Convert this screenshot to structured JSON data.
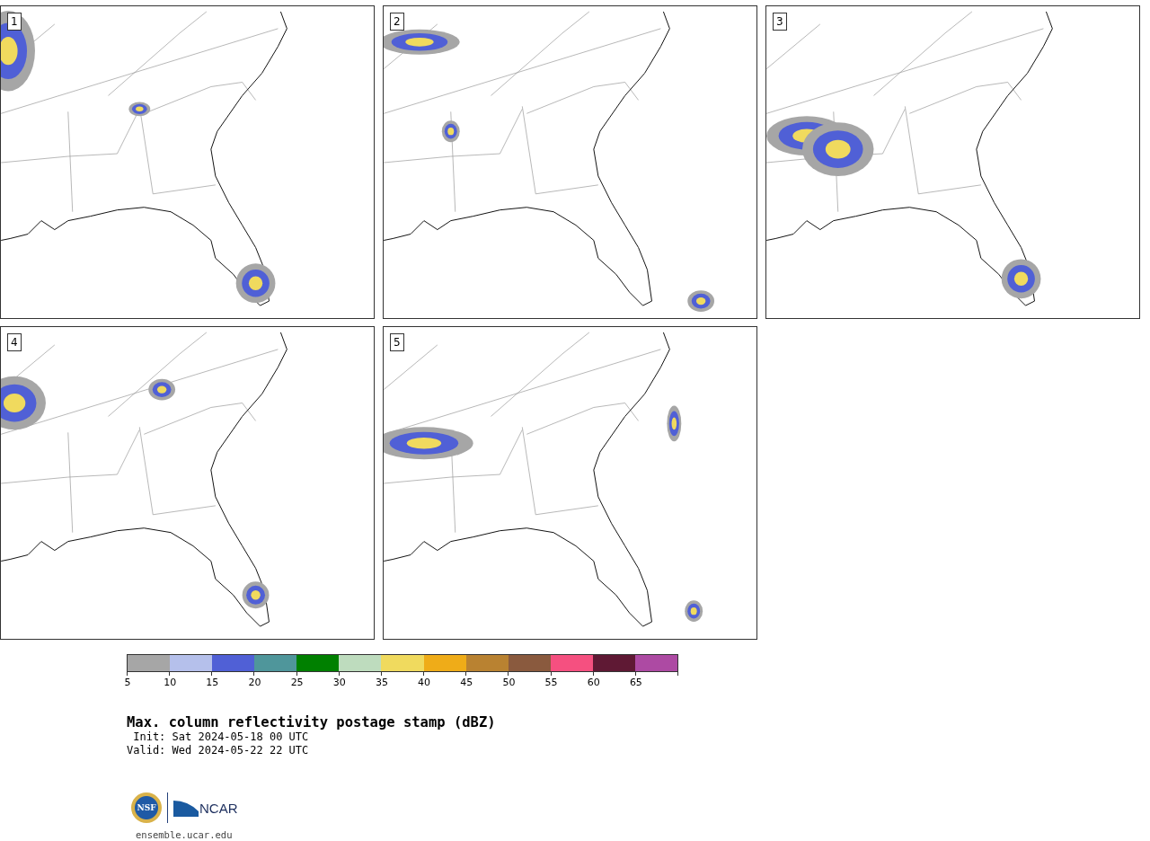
{
  "panels": [
    {
      "label": "1"
    },
    {
      "label": "2"
    },
    {
      "label": "3"
    },
    {
      "label": "4"
    },
    {
      "label": "5"
    }
  ],
  "colorbar": {
    "segments": [
      {
        "color": "#a6a6a6",
        "tick": "5"
      },
      {
        "color": "#b5c0eb",
        "tick": "10"
      },
      {
        "color": "#5060d6",
        "tick": "15"
      },
      {
        "color": "#4f969b",
        "tick": "20"
      },
      {
        "color": "#008000",
        "tick": "25"
      },
      {
        "color": "#bedcbe",
        "tick": "30"
      },
      {
        "color": "#f0da5e",
        "tick": "35"
      },
      {
        "color": "#efac18",
        "tick": "40"
      },
      {
        "color": "#b98231",
        "tick": "45"
      },
      {
        "color": "#8a5a3e",
        "tick": "50"
      },
      {
        "color": "#f55080",
        "tick": "55"
      },
      {
        "color": "#5f1934",
        "tick": "60"
      },
      {
        "color": "#ad4aa3",
        "tick": "65"
      }
    ]
  },
  "title": "Max. column reflectivity postage stamp (dBZ)",
  "init": " Init: Sat 2024-05-18 00 UTC",
  "valid": "Valid: Wed 2024-05-22 22 UTC",
  "logos": {
    "nsf": "NSF",
    "ncar": "NCAR"
  },
  "url": "ensemble.ucar.edu"
}
